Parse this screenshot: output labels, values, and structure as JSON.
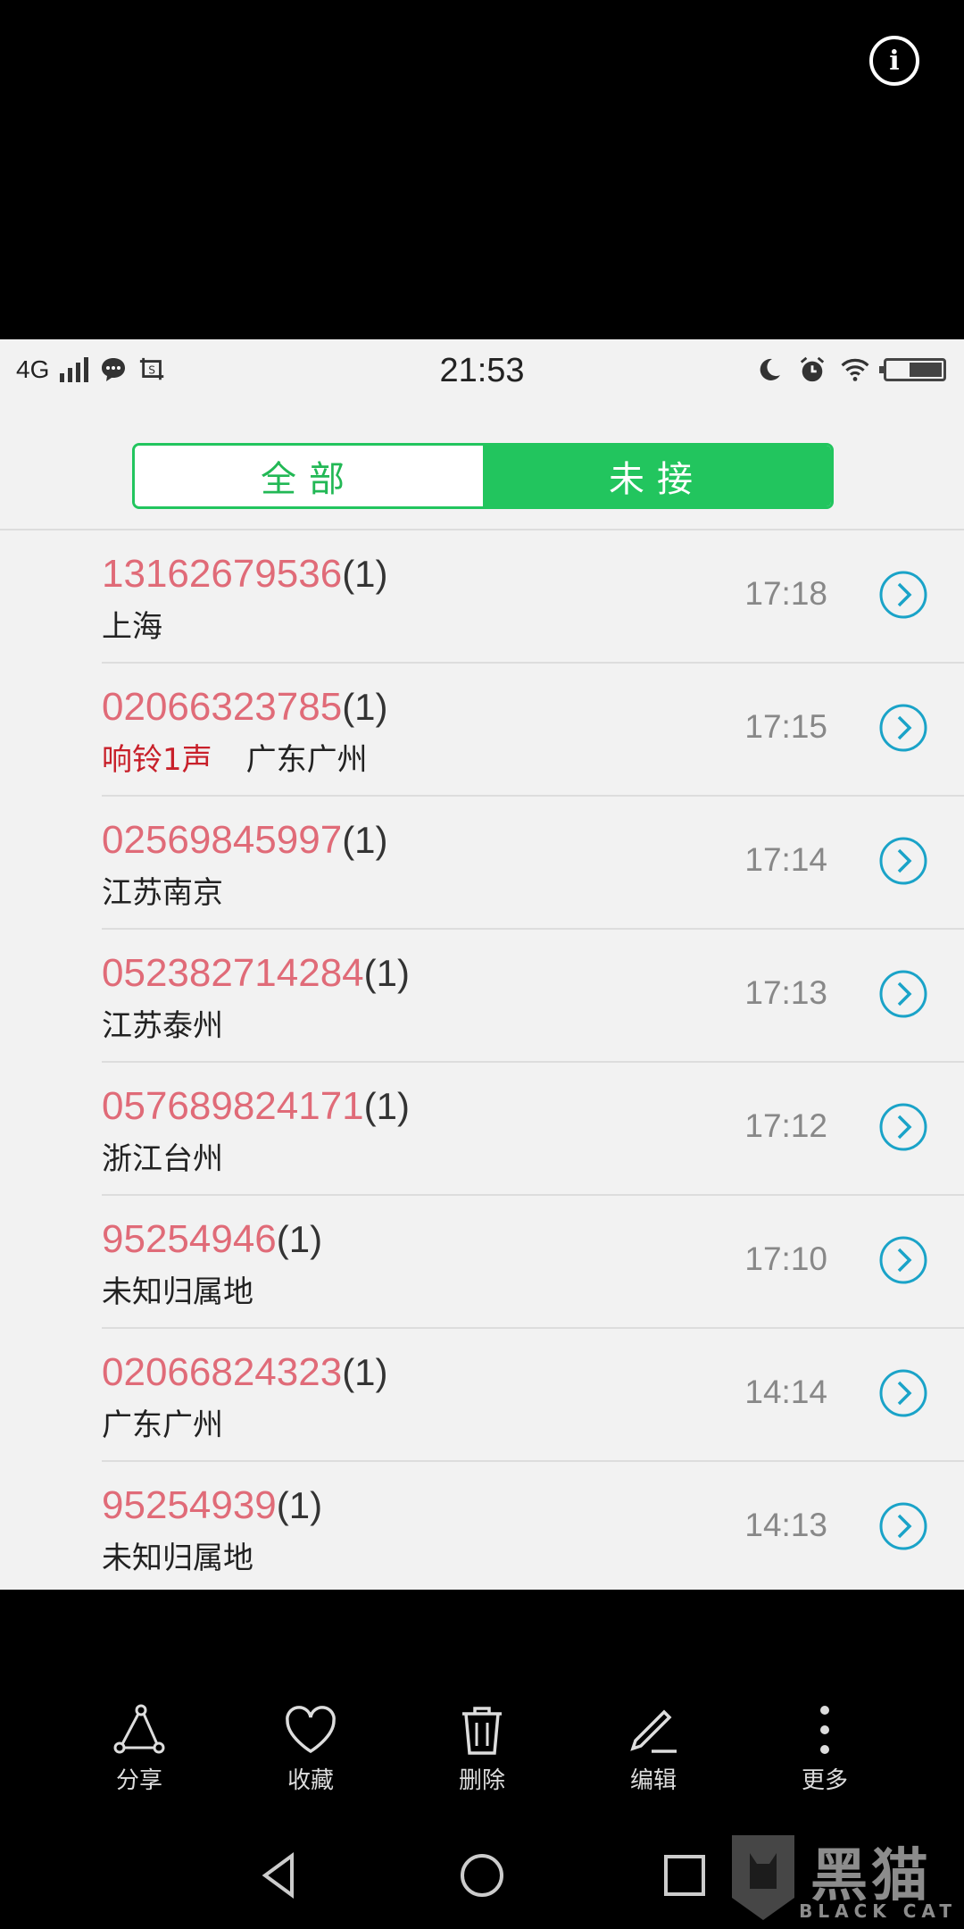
{
  "status_bar": {
    "network": "4G",
    "time": "21:53"
  },
  "tabs": {
    "all_label": "全部",
    "missed_label": "未接",
    "active": "missed"
  },
  "calls": [
    {
      "number": "13162679536",
      "count": "(1)",
      "ring": "",
      "location": "上海",
      "time": "17:18"
    },
    {
      "number": "02066323785",
      "count": "(1)",
      "ring": "响铃1声",
      "location": "广东广州",
      "time": "17:15"
    },
    {
      "number": "02569845997",
      "count": "(1)",
      "ring": "",
      "location": "江苏南京",
      "time": "17:14"
    },
    {
      "number": "052382714284",
      "count": "(1)",
      "ring": "",
      "location": "江苏泰州",
      "time": "17:13"
    },
    {
      "number": "057689824171",
      "count": "(1)",
      "ring": "",
      "location": "浙江台州",
      "time": "17:12"
    },
    {
      "number": "95254946",
      "count": "(1)",
      "ring": "",
      "location": "未知归属地",
      "time": "17:10"
    },
    {
      "number": "02066824323",
      "count": "(1)",
      "ring": "",
      "location": "广东广州",
      "time": "14:14"
    },
    {
      "number": "95254939",
      "count": "(1)",
      "ring": "",
      "location": "未知归属地",
      "time": "14:13"
    }
  ],
  "toolbar": {
    "share": "分享",
    "favorite": "收藏",
    "delete": "删除",
    "edit": "编辑",
    "more": "更多"
  },
  "watermark": {
    "text": "黑猫",
    "sub": "BLACK CAT"
  },
  "colors": {
    "accent_green": "#22c55e",
    "number_pink": "#e06b78",
    "ring_red": "#c8202a",
    "arrow_blue": "#1aa3c8"
  }
}
